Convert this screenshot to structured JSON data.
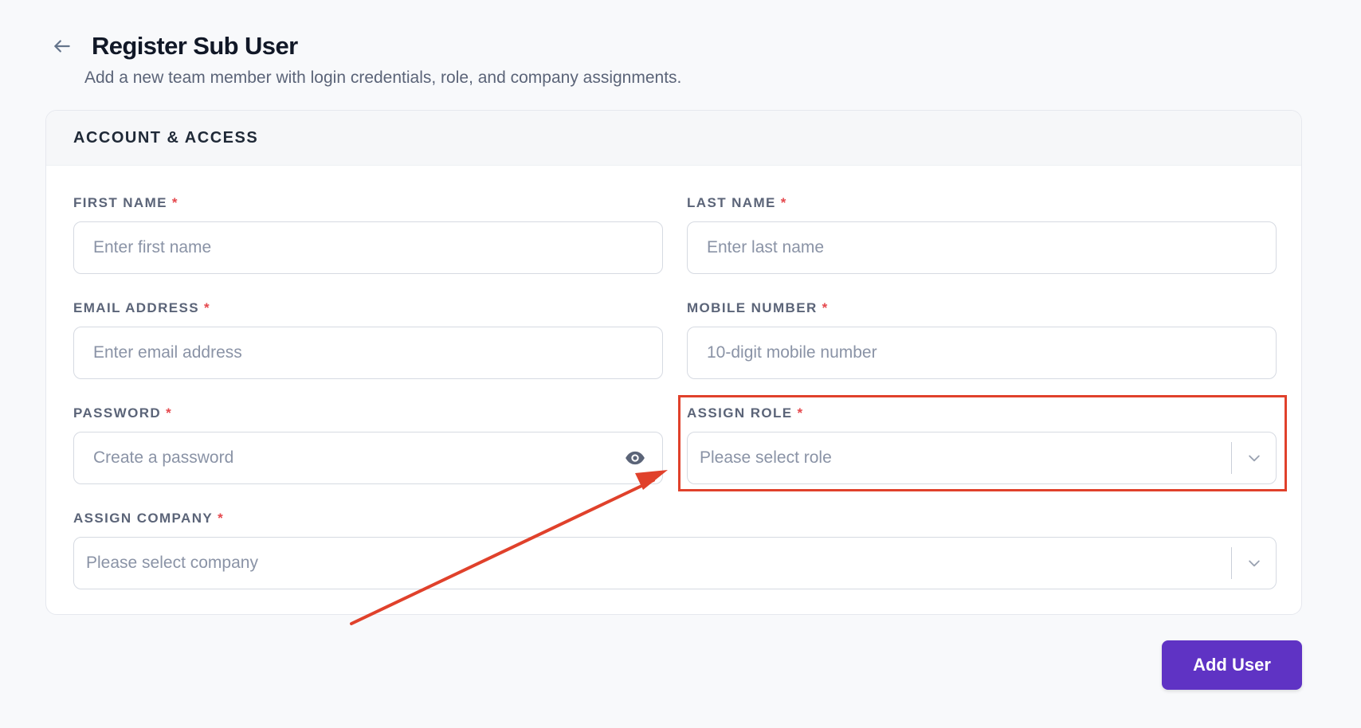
{
  "header": {
    "back_icon": "arrow-left-icon",
    "title": "Register Sub User",
    "subtitle": "Add a new team member with login credentials, role, and company assignments."
  },
  "section": {
    "title": "ACCOUNT & ACCESS"
  },
  "fields": {
    "first_name": {
      "label": "FIRST NAME",
      "required": "*",
      "placeholder": "Enter first name",
      "value": ""
    },
    "last_name": {
      "label": "LAST NAME",
      "required": "*",
      "placeholder": "Enter last name",
      "value": ""
    },
    "email": {
      "label": "EMAIL ADDRESS",
      "required": "*",
      "placeholder": "Enter email address",
      "value": ""
    },
    "mobile": {
      "label": "MOBILE NUMBER",
      "required": "*",
      "placeholder": "10-digit mobile number",
      "value": ""
    },
    "password": {
      "label": "PASSWORD",
      "required": "*",
      "placeholder": "Create a password",
      "value": "",
      "toggle_icon": "eye-icon"
    },
    "role": {
      "label": "ASSIGN ROLE",
      "required": "*",
      "placeholder": "Please select role",
      "icon": "chevron-down-icon"
    },
    "company": {
      "label": "ASSIGN COMPANY",
      "required": "*",
      "placeholder": "Please select company",
      "icon": "chevron-down-icon"
    }
  },
  "actions": {
    "submit_label": "Add User"
  },
  "annotation": {
    "color": "#e0412b",
    "target": "ASSIGN ROLE"
  },
  "colors": {
    "primary": "#5f33c4",
    "required": "#e5484d",
    "background": "#f8f9fb"
  }
}
